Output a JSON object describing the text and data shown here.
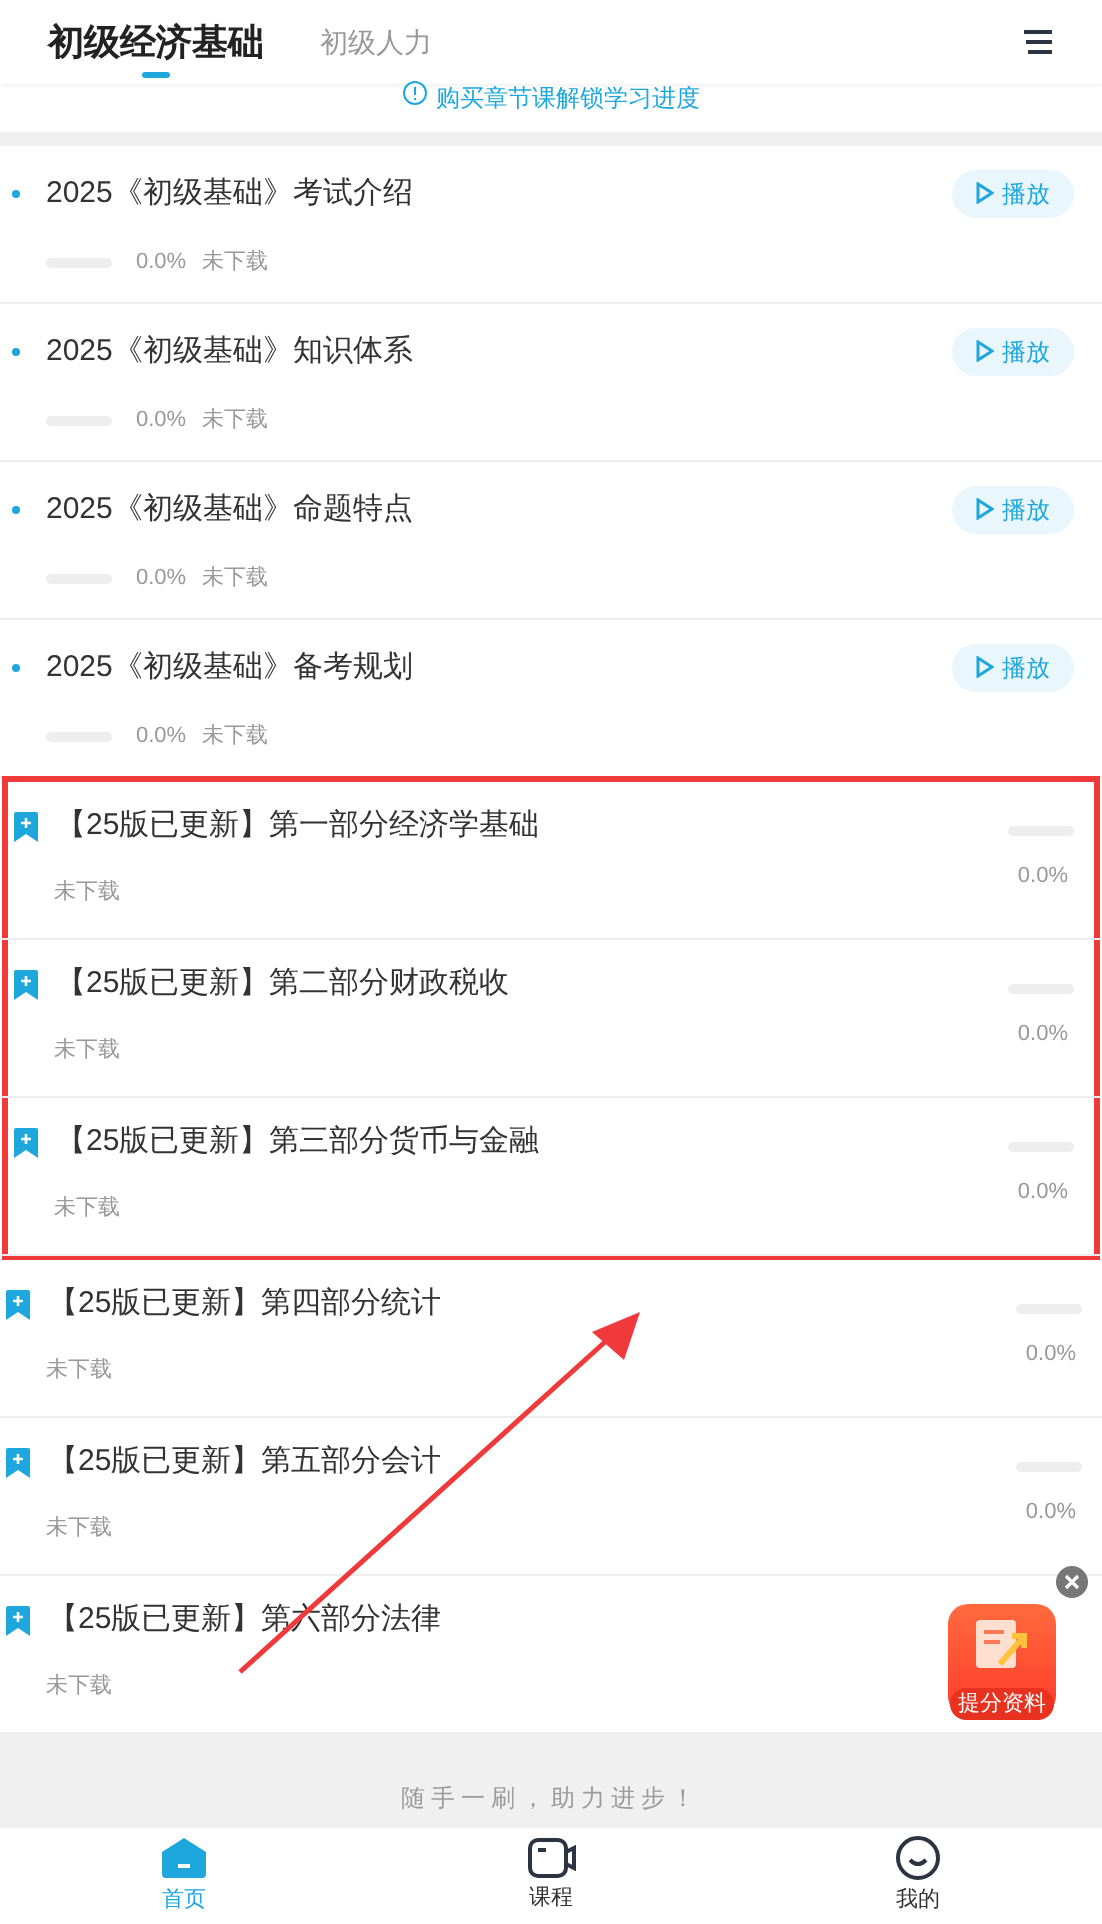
{
  "tabs": [
    {
      "label": "初级经济基础",
      "selected": true
    },
    {
      "label": "初级人力",
      "selected": false
    }
  ],
  "notice": "购买章节课解锁学习进度",
  "lessons": [
    {
      "title": "2025《初级基础》考试介绍",
      "percent": "0.0%",
      "status": "未下载",
      "level": 0,
      "action": "播放"
    },
    {
      "title": "2025《初级基础》知识体系",
      "percent": "0.0%",
      "status": "未下载",
      "level": 0,
      "action": "播放"
    },
    {
      "title": "2025《初级基础》命题特点",
      "percent": "0.0%",
      "status": "未下载",
      "level": 0,
      "action": "播放"
    },
    {
      "title": "2025《初级基础》备考规划",
      "percent": "0.0%",
      "status": "未下载",
      "level": 0,
      "action": "播放"
    }
  ],
  "chapter_groups": [
    {
      "highlighted": true,
      "chapters": [
        {
          "title": "【25版已更新】第一部分经济学基础",
          "status": "未下载",
          "percent": "0.0%"
        },
        {
          "title": "【25版已更新】第二部分财政税收",
          "status": "未下载",
          "percent": "0.0%"
        },
        {
          "title": "【25版已更新】第三部分货币与金融",
          "status": "未下载",
          "percent": "0.0%"
        }
      ]
    },
    {
      "highlighted": false,
      "chapters": [
        {
          "title": "【25版已更新】第四部分统计",
          "status": "未下载",
          "percent": "0.0%"
        },
        {
          "title": "【25版已更新】第五部分会计",
          "status": "未下载",
          "percent": "0.0%"
        },
        {
          "title": "【25版已更新】第六部分法律",
          "status": "未下载"
        }
      ]
    }
  ],
  "annotation_arrow": true,
  "promo": {
    "label": "提分资料"
  },
  "slogan": "随手一刷，助力进步！",
  "nav": [
    {
      "label": "首页",
      "kind": "home",
      "selected": true
    },
    {
      "label": "课程",
      "kind": "video",
      "selected": false
    },
    {
      "label": "我的",
      "kind": "smile",
      "selected": false
    }
  ]
}
